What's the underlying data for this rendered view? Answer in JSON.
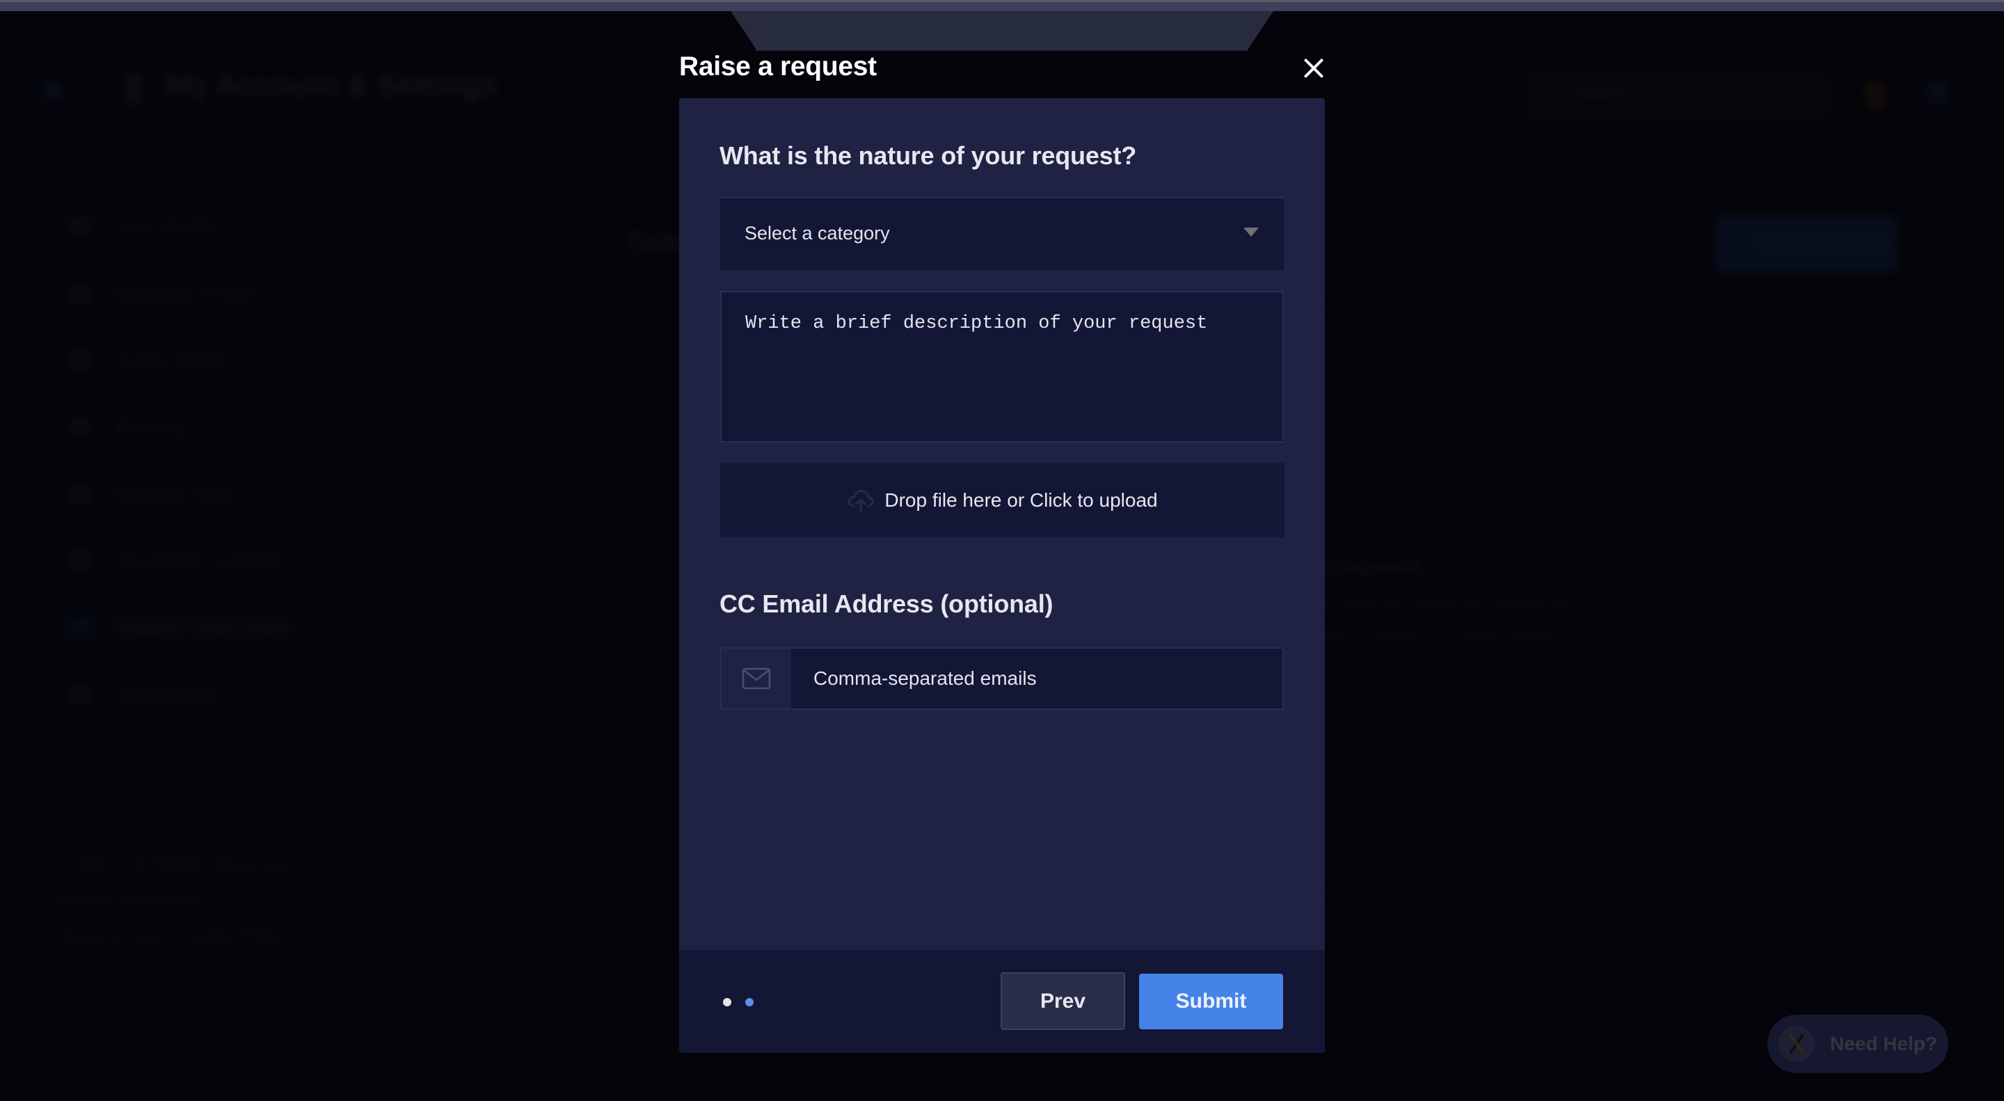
{
  "background": {
    "header_title": "My Account & Settings",
    "search_placeholder": "Search",
    "sidebar_items": [
      {
        "label": "User Profile"
      },
      {
        "label": "Business Profile"
      },
      {
        "label": "Public Profile"
      },
      {
        "label": "Banking"
      },
      {
        "label": "Manage Team"
      },
      {
        "label": "Developer Controls"
      },
      {
        "label": "Support Ticket Inbox",
        "active": true
      },
      {
        "label": "Integrations"
      }
    ],
    "sidebar_footer": [
      "© 2023 · All Rights Reserved",
      "Privacy Statement",
      "Terms of Use  ·  Cookie Policy"
    ],
    "page_title": "Tickets",
    "new_request_button": "+ New request",
    "empty_state_title": "No requests",
    "empty_state_lines": [
      "You have not raised any request yet.",
      "Raise a request to contact support."
    ],
    "help_button": "Need Help?"
  },
  "modal": {
    "title": "Raise a request",
    "close_icon": "close-icon",
    "step_question": "What is the nature of your request?",
    "category_select": {
      "value": "Select a category",
      "icon": "caret-down-icon"
    },
    "description": {
      "placeholder": "Write a brief description of your request",
      "value": ""
    },
    "upload": {
      "label": "Drop file here or Click to upload",
      "icon": "cloud-upload-icon"
    },
    "cc_label": "CC Email Address (optional)",
    "cc_email": {
      "placeholder": "Comma-separated emails",
      "value": "",
      "icon": "envelope-icon"
    },
    "pagination": {
      "total_steps": 2,
      "current_step": 2,
      "inactive_color": "#e6e6e6",
      "active_color": "#5b8def"
    },
    "prev_button": "Prev",
    "submit_button": "Submit",
    "accent_color": "#4683e8"
  }
}
